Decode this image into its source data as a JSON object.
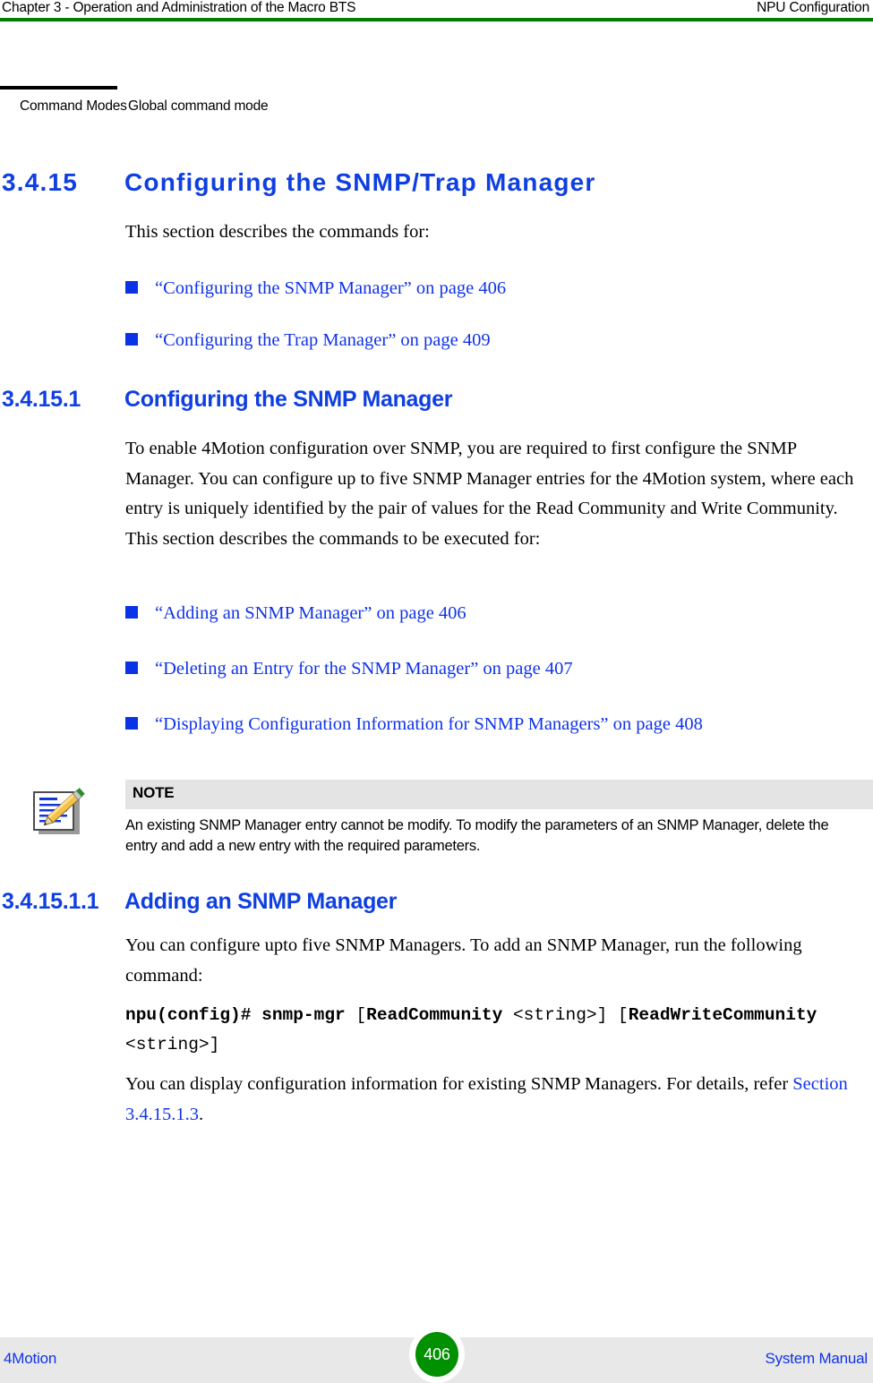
{
  "header": {
    "left": "Chapter 3 - Operation and Administration of the Macro BTS",
    "right": "NPU Configuration",
    "rule_color": "#007F00"
  },
  "command_modes_table": {
    "label": "Command Modes",
    "value": "Global command mode"
  },
  "section": {
    "number": "3.4.15",
    "title": "Configuring the SNMP/Trap Manager",
    "intro": "This section describes the commands for:",
    "links": [
      "“Configuring the SNMP Manager” on page 406",
      "“Configuring the Trap Manager” on page 409"
    ]
  },
  "subsection": {
    "number": "3.4.15.1",
    "title": "Configuring the SNMP Manager",
    "paragraph": "To enable 4Motion configuration over SNMP, you are required to first configure the SNMP Manager. You can configure up to five SNMP Manager entries for the 4Motion system, where each entry is uniquely identified by the pair of values for the Read Community and Write Community. This section describes the commands to be executed for:",
    "links": [
      "“Adding an SNMP Manager” on page 406",
      "“Deleting an Entry for the SNMP Manager” on page 407",
      "“Displaying Configuration Information for SNMP Managers” on page 408"
    ]
  },
  "note": {
    "icon": "note-pencil-icon",
    "title": "NOTE",
    "body": "An existing SNMP Manager entry cannot be modify. To modify the parameters of an SNMP Manager, delete the entry and add a new entry with the required parameters."
  },
  "subsubsection": {
    "number": "3.4.15.1.1",
    "title": "Adding an SNMP Manager",
    "paragraph": "You can configure upto five SNMP Managers. To add an SNMP Manager, run the following command:",
    "command": {
      "prompt": "npu(config)# snmp-mgr",
      "open_bracket_1": "[",
      "param_1": "ReadCommunity",
      "value_1": "<string>",
      "close_bracket_1": "]",
      "open_bracket_2": "[",
      "param_2": "ReadWriteCommunity",
      "value_2": "<string>",
      "close_bracket_2": "]"
    },
    "closing_text_before": "You can display configuration information for existing SNMP Managers. For details, refer ",
    "closing_xref": "Section 3.4.15.1.3",
    "closing_text_after": "."
  },
  "footer": {
    "left": "4Motion",
    "page": "406",
    "right": "System Manual",
    "page_badge_color": "#009000"
  },
  "colors": {
    "heading_blue": "#0F3FE0",
    "link_blue": "#1033E8",
    "rule_green": "#007F00",
    "note_bar_gray": "#E4E4E4",
    "footer_gray": "#E8E8E8"
  }
}
